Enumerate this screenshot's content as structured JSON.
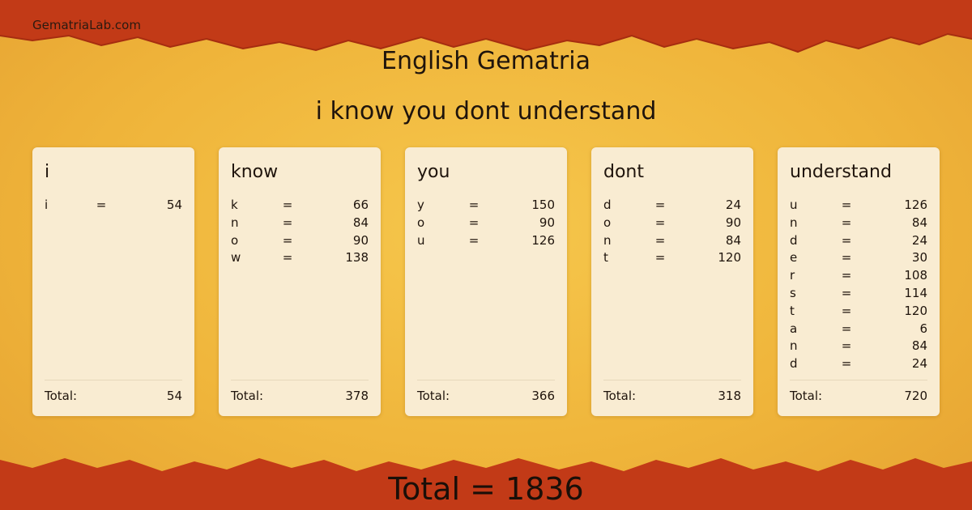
{
  "site": {
    "label": "GematriaLab.com"
  },
  "header": {
    "title": "English Gematria",
    "phrase": "i know you dont understand"
  },
  "colors": {
    "background": "#f0b83c",
    "band": "#c23a17",
    "card": "#f9ecd2",
    "text": "#1f140c"
  },
  "cards": [
    {
      "word": "i",
      "letters": [
        {
          "letter": "i",
          "eq": "=",
          "value": "54"
        }
      ],
      "total_label": "Total:",
      "total": "54"
    },
    {
      "word": "know",
      "letters": [
        {
          "letter": "k",
          "eq": "=",
          "value": "66"
        },
        {
          "letter": "n",
          "eq": "=",
          "value": "84"
        },
        {
          "letter": "o",
          "eq": "=",
          "value": "90"
        },
        {
          "letter": "w",
          "eq": "=",
          "value": "138"
        }
      ],
      "total_label": "Total:",
      "total": "378"
    },
    {
      "word": "you",
      "letters": [
        {
          "letter": "y",
          "eq": "=",
          "value": "150"
        },
        {
          "letter": "o",
          "eq": "=",
          "value": "90"
        },
        {
          "letter": "u",
          "eq": "=",
          "value": "126"
        }
      ],
      "total_label": "Total:",
      "total": "366"
    },
    {
      "word": "dont",
      "letters": [
        {
          "letter": "d",
          "eq": "=",
          "value": "24"
        },
        {
          "letter": "o",
          "eq": "=",
          "value": "90"
        },
        {
          "letter": "n",
          "eq": "=",
          "value": "84"
        },
        {
          "letter": "t",
          "eq": "=",
          "value": "120"
        }
      ],
      "total_label": "Total:",
      "total": "318"
    },
    {
      "word": "understand",
      "letters": [
        {
          "letter": "u",
          "eq": "=",
          "value": "126"
        },
        {
          "letter": "n",
          "eq": "=",
          "value": "84"
        },
        {
          "letter": "d",
          "eq": "=",
          "value": "24"
        },
        {
          "letter": "e",
          "eq": "=",
          "value": "30"
        },
        {
          "letter": "r",
          "eq": "=",
          "value": "108"
        },
        {
          "letter": "s",
          "eq": "=",
          "value": "114"
        },
        {
          "letter": "t",
          "eq": "=",
          "value": "120"
        },
        {
          "letter": "a",
          "eq": "=",
          "value": "6"
        },
        {
          "letter": "n",
          "eq": "=",
          "value": "84"
        },
        {
          "letter": "d",
          "eq": "=",
          "value": "24"
        }
      ],
      "total_label": "Total:",
      "total": "720"
    }
  ],
  "grand_total": {
    "text": "Total = 1836"
  }
}
